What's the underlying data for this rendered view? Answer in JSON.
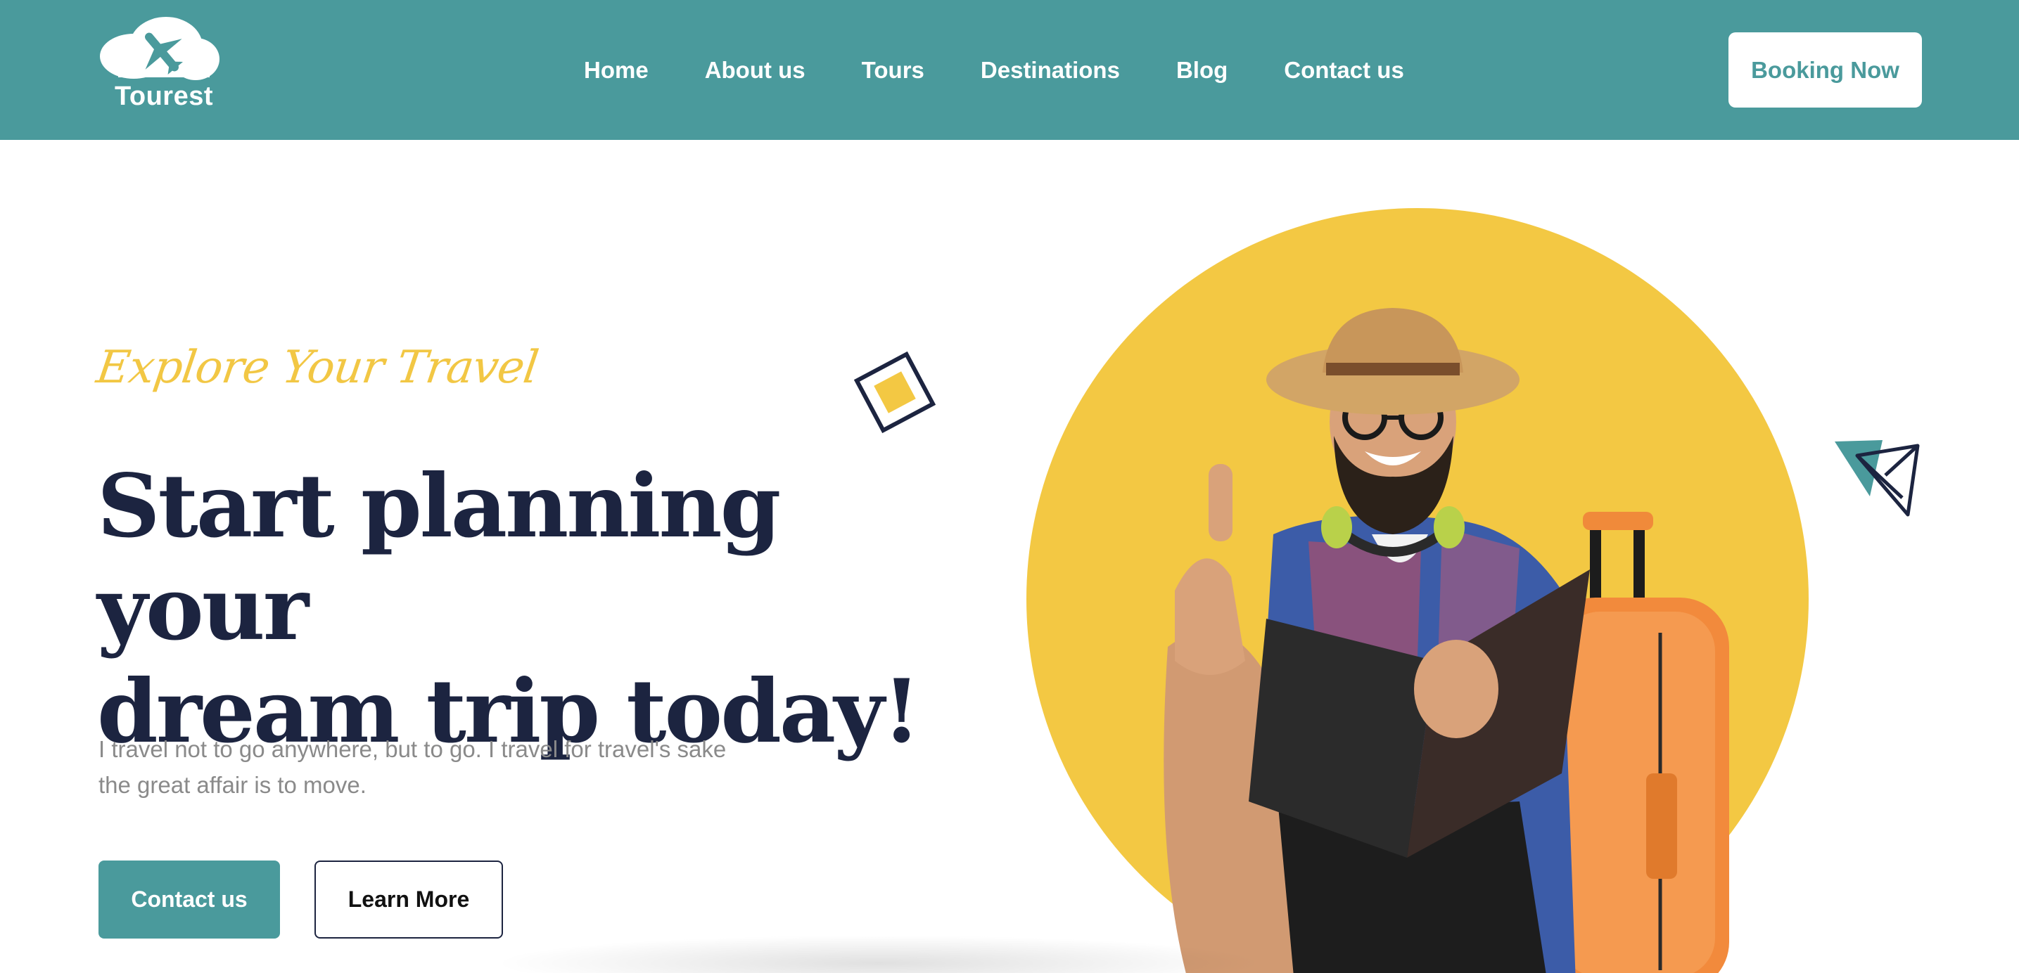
{
  "brand": {
    "name": "Tourest"
  },
  "nav": {
    "items": [
      {
        "label": "Home"
      },
      {
        "label": "About us"
      },
      {
        "label": "Tours"
      },
      {
        "label": "Destinations"
      },
      {
        "label": "Blog"
      },
      {
        "label": "Contact us"
      }
    ],
    "cta_label": "Booking Now"
  },
  "hero": {
    "tagline": "Explore Your Travel",
    "headline_line1": "Start planning your",
    "headline_line2": "dream trip today!",
    "subtext_line1": "I travel not to go anywhere, but to go. I travel for travel's sake",
    "subtext_line2": "the great affair is to move.",
    "primary_button": "Contact us",
    "secondary_button": "Learn More"
  },
  "icons": {
    "logo": "cloud-plane-icon",
    "square": "diamond-square-icon",
    "paper_plane": "paper-plane-icon"
  },
  "colors": {
    "primary": "#4a9a9c",
    "accent": "#f3c843",
    "heading": "#1c2440",
    "body_text": "#8a8a8a",
    "white": "#ffffff"
  }
}
